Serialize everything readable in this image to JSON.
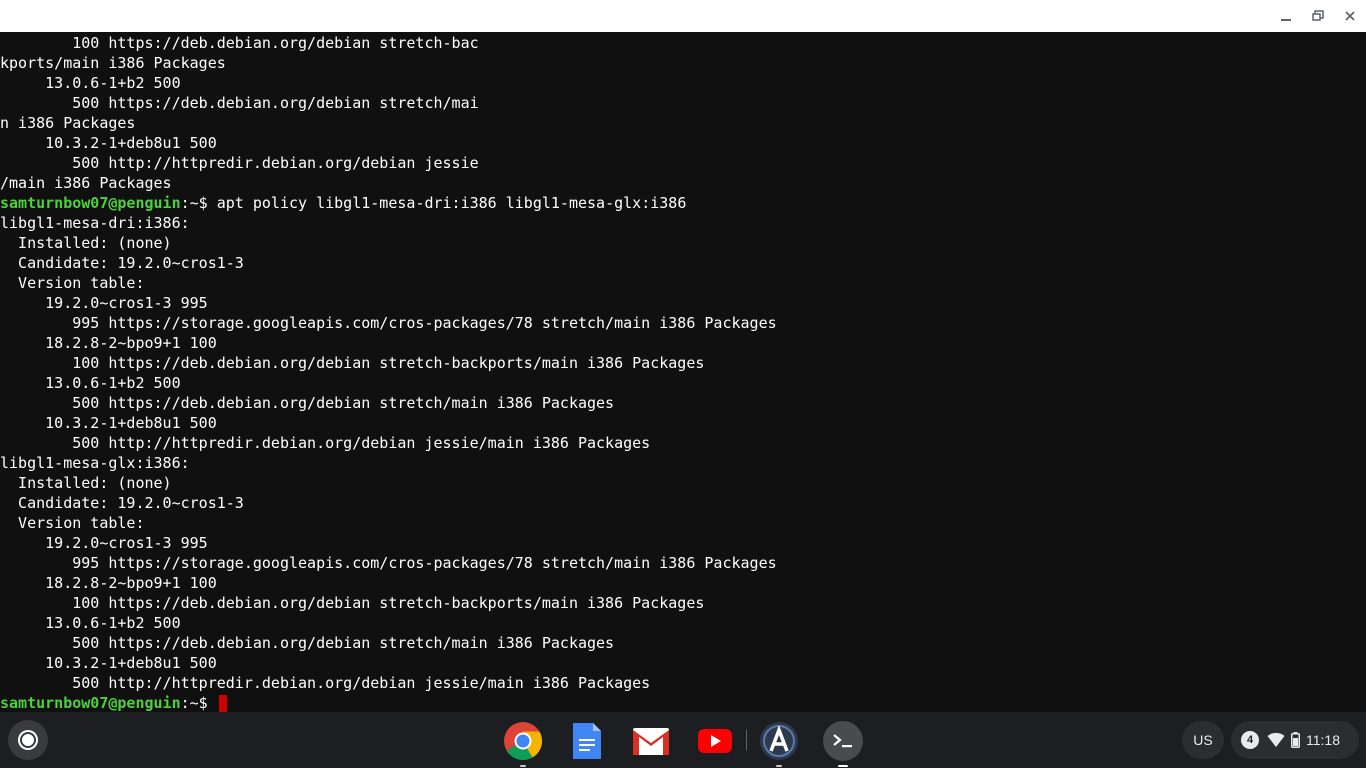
{
  "window": {
    "controls": {
      "minimize": "minimize",
      "maximize": "restore",
      "close": "close"
    }
  },
  "terminal": {
    "lines": [
      {
        "text": "        100 https://deb.debian.org/debian stretch-bac"
      },
      {
        "text": "kports/main i386 Packages"
      },
      {
        "text": "     13.0.6-1+b2 500"
      },
      {
        "text": "        500 https://deb.debian.org/debian stretch/mai"
      },
      {
        "text": "n i386 Packages"
      },
      {
        "text": "     10.3.2-1+deb8u1 500"
      },
      {
        "text": "        500 http://httpredir.debian.org/debian jessie"
      },
      {
        "text": "/main i386 Packages"
      },
      {
        "prompt_user": "samturnbow07@penguin",
        "prompt_path": ":~$ ",
        "command": "apt policy libgl1-mesa-dri:i386 libgl1-mesa-glx:i386"
      },
      {
        "text": "libgl1-mesa-dri:i386:"
      },
      {
        "text": "  Installed: (none)"
      },
      {
        "text": "  Candidate: 19.2.0~cros1-3"
      },
      {
        "text": "  Version table:"
      },
      {
        "text": "     19.2.0~cros1-3 995"
      },
      {
        "text": "        995 https://storage.googleapis.com/cros-packages/78 stretch/main i386 Packages"
      },
      {
        "text": "     18.2.8-2~bpo9+1 100"
      },
      {
        "text": "        100 https://deb.debian.org/debian stretch-backports/main i386 Packages"
      },
      {
        "text": "     13.0.6-1+b2 500"
      },
      {
        "text": "        500 https://deb.debian.org/debian stretch/main i386 Packages"
      },
      {
        "text": "     10.3.2-1+deb8u1 500"
      },
      {
        "text": "        500 http://httpredir.debian.org/debian jessie/main i386 Packages"
      },
      {
        "text": "libgl1-mesa-glx:i386:"
      },
      {
        "text": "  Installed: (none)"
      },
      {
        "text": "  Candidate: 19.2.0~cros1-3"
      },
      {
        "text": "  Version table:"
      },
      {
        "text": "     19.2.0~cros1-3 995"
      },
      {
        "text": "        995 https://storage.googleapis.com/cros-packages/78 stretch/main i386 Packages"
      },
      {
        "text": "     18.2.8-2~bpo9+1 100"
      },
      {
        "text": "        100 https://deb.debian.org/debian stretch-backports/main i386 Packages"
      },
      {
        "text": "     13.0.6-1+b2 500"
      },
      {
        "text": "        500 https://deb.debian.org/debian stretch/main i386 Packages"
      },
      {
        "text": "     10.3.2-1+deb8u1 500"
      },
      {
        "text": "        500 http://httpredir.debian.org/debian jessie/main i386 Packages"
      },
      {
        "prompt_user": "samturnbow07@penguin",
        "prompt_path": ":~$ ",
        "command": "",
        "cursor": true
      }
    ]
  },
  "shelf": {
    "apps": [
      {
        "name": "chrome-icon",
        "running": true
      },
      {
        "name": "google-docs-icon",
        "running": false
      },
      {
        "name": "gmail-icon",
        "running": false
      },
      {
        "name": "youtube-icon",
        "running": false
      },
      {
        "name": "android-studio-icon",
        "running": true
      },
      {
        "name": "terminal-icon",
        "running": true,
        "active": true
      }
    ],
    "ime": "US",
    "notification_count": "4",
    "clock": "11:18"
  },
  "colors": {
    "terminal_bg": "#101010",
    "prompt_user": "#4cd13b",
    "cursor": "#d10000",
    "shelf_bg": "#1d1e21"
  }
}
